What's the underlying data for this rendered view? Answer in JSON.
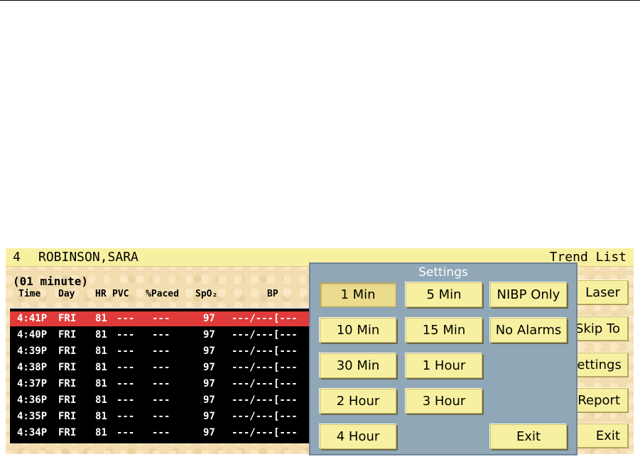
{
  "header": {
    "bed": "4",
    "patient_name": "ROBINSON,SARA",
    "mode": "Trend List"
  },
  "interval": "(01 minute)",
  "columns": [
    "Time",
    "Day",
    "HR",
    "PVC",
    "%Paced",
    "SpO₂",
    "BP"
  ],
  "rows": [
    {
      "time": "4:41P",
      "day": "FRI",
      "hr": "81",
      "pvc": "---",
      "paced": "---",
      "spo2": "97",
      "bp": "---/---[---"
    },
    {
      "time": "4:40P",
      "day": "FRI",
      "hr": "81",
      "pvc": "---",
      "paced": "---",
      "spo2": "97",
      "bp": "---/---[---"
    },
    {
      "time": "4:39P",
      "day": "FRI",
      "hr": "81",
      "pvc": "---",
      "paced": "---",
      "spo2": "97",
      "bp": "---/---[---"
    },
    {
      "time": "4:38P",
      "day": "FRI",
      "hr": "81",
      "pvc": "---",
      "paced": "---",
      "spo2": "97",
      "bp": "---/---[---"
    },
    {
      "time": "4:37P",
      "day": "FRI",
      "hr": "81",
      "pvc": "---",
      "paced": "---",
      "spo2": "97",
      "bp": "---/---[---"
    },
    {
      "time": "4:36P",
      "day": "FRI",
      "hr": "81",
      "pvc": "---",
      "paced": "---",
      "spo2": "97",
      "bp": "---/---[---"
    },
    {
      "time": "4:35P",
      "day": "FRI",
      "hr": "81",
      "pvc": "---",
      "paced": "---",
      "spo2": "97",
      "bp": "---/---[---"
    },
    {
      "time": "4:34P",
      "day": "FRI",
      "hr": "81",
      "pvc": "---",
      "paced": "---",
      "spo2": "97",
      "bp": "---/---[---"
    }
  ],
  "right_buttons": [
    "Laser",
    "Skip To",
    "Settings",
    "Report",
    "Exit"
  ],
  "settings": {
    "title": "Settings",
    "buttons": {
      "min1": "1 Min",
      "min5": "5 Min",
      "nibp_only": "NIBP Only",
      "min10": "10 Min",
      "min15": "15 Min",
      "no_alarms": "No Alarms",
      "min30": "30 Min",
      "hour1": "1 Hour",
      "hour2": "2 Hour",
      "hour3": "3 Hour",
      "hour4": "4 Hour",
      "exit": "Exit"
    },
    "selected": "1 Min"
  },
  "colors": {
    "selected_row": "#e03a3a",
    "button": "#f7f0a0",
    "panel": "#8fa7b7"
  }
}
